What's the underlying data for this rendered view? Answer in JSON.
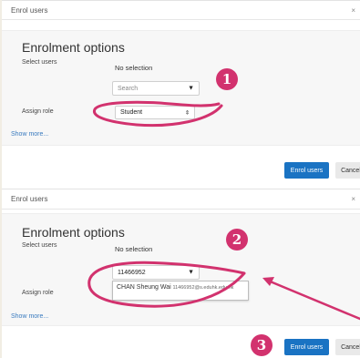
{
  "panel1": {
    "title": "Enrol users",
    "close": "×",
    "heading": "Enrolment options",
    "select_users_label": "Select users",
    "select_users_value": "No selection",
    "search_placeholder": "Search",
    "assign_role_label": "Assign role",
    "assign_role_value": "Student",
    "show_more": "Show more...",
    "enrol_button": "Enrol users",
    "cancel_button": "Cancel",
    "badge": "1"
  },
  "panel2": {
    "title": "Enrol users",
    "close": "×",
    "heading": "Enrolment options",
    "select_users_label": "Select users",
    "select_users_value": "No selection",
    "search_value": "11466952",
    "suggestion_name": "CHAN Sheung Wai",
    "suggestion_email": "11466952@s.eduhk.edu.hk",
    "assign_role_label": "Assign role",
    "show_more": "Show more...",
    "enrol_button": "Enrol users",
    "cancel_button": "Cancel",
    "badge2": "2",
    "badge3": "3"
  },
  "icons": {
    "dropdown": "▼",
    "select_updown": "⇕"
  },
  "colors": {
    "accent": "#1a73c3",
    "annotation": "#d2326e"
  }
}
